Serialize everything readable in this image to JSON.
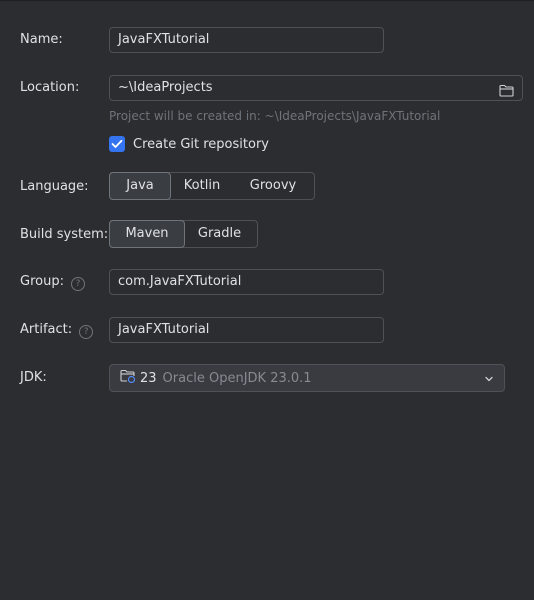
{
  "form": {
    "name_label": "Name:",
    "name_value": "JavaFXTutorial",
    "location_label": "Location:",
    "location_value": "~\\IdeaProjects",
    "location_hint": "Project will be created in: ~\\IdeaProjects\\JavaFXTutorial",
    "git_label": "Create Git repository",
    "git_checked": true,
    "language_label": "Language:",
    "languages": [
      "Java",
      "Kotlin",
      "Groovy"
    ],
    "language_selected": "Java",
    "build_label": "Build system:",
    "build_systems": [
      "Maven",
      "Gradle"
    ],
    "build_selected": "Maven",
    "group_label": "Group:",
    "group_value": "com.JavaFXTutorial",
    "artifact_label": "Artifact:",
    "artifact_value": "JavaFXTutorial",
    "help_glyph": "?",
    "jdk_label": "JDK:",
    "jdk_version": "23",
    "jdk_name": "Oracle OpenJDK 23.0.1"
  },
  "icons": {
    "folder": "folder-icon",
    "checkmark": "check-icon",
    "help": "help-icon",
    "jdk": "jdk-folder-icon",
    "dropdown": "chevron-down-icon"
  },
  "colors": {
    "background": "#2b2d30",
    "accent": "#3574f0",
    "border": "#4e5157",
    "hint": "#6f737a"
  }
}
